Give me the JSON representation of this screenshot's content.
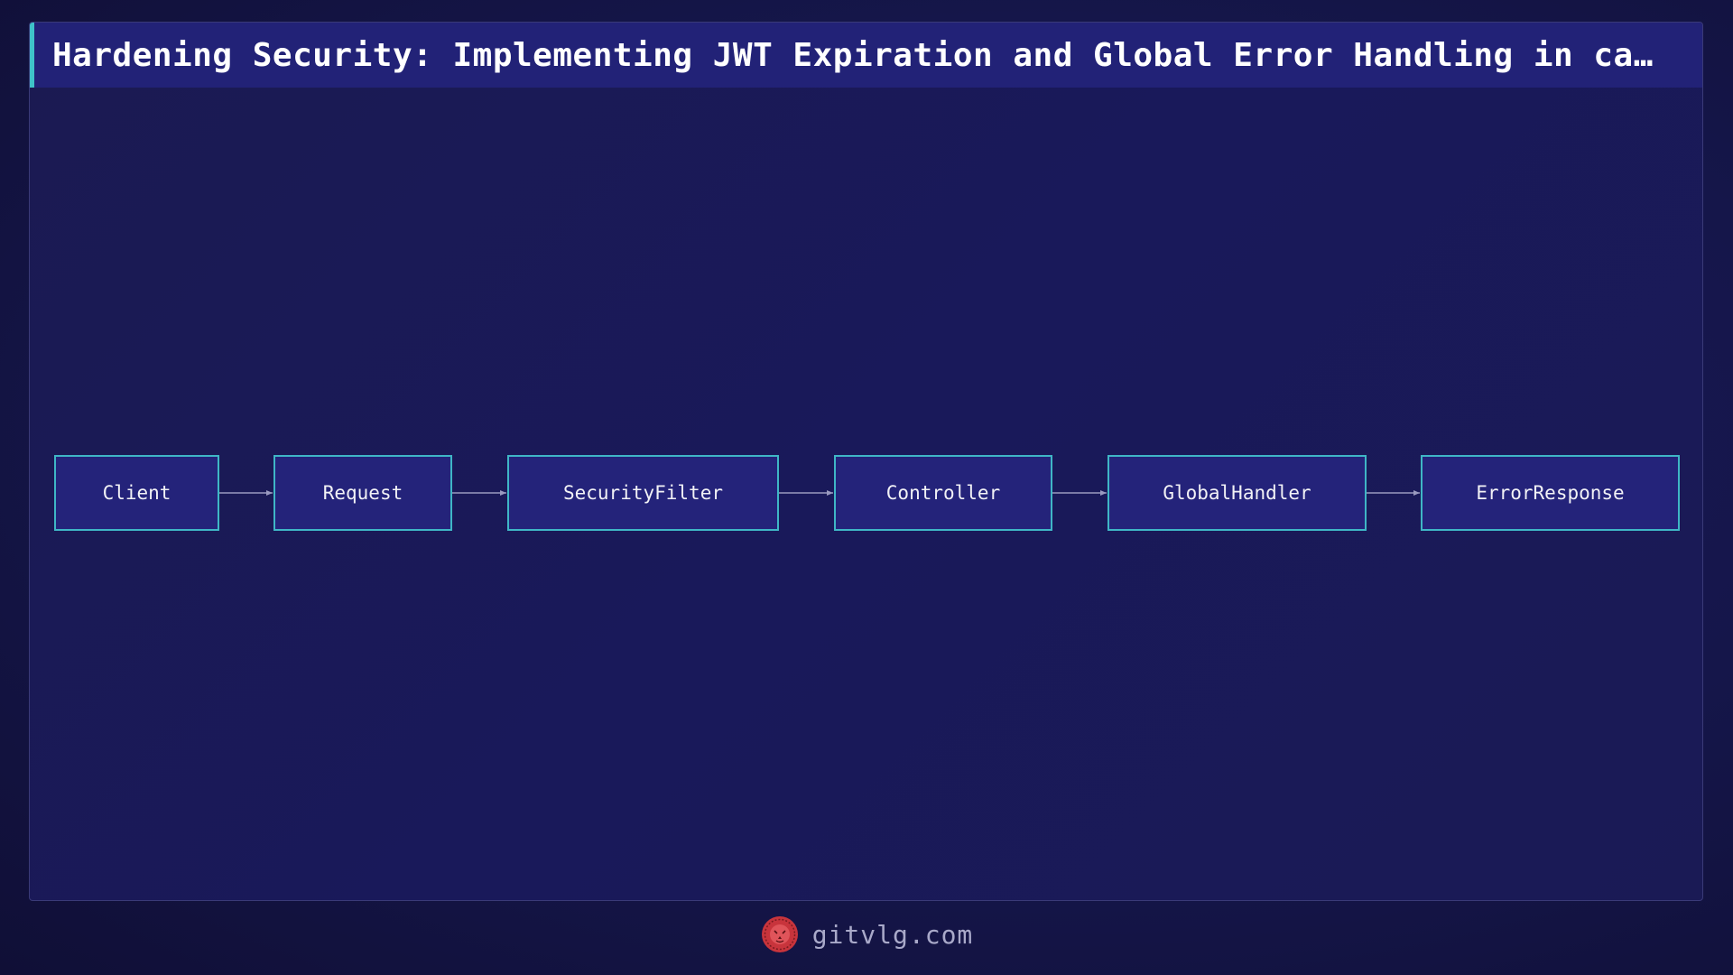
{
  "title": "Hardening Security: Implementing JWT Expiration and Global Error Handling in ca…",
  "diagram": {
    "nodes": [
      {
        "id": "client",
        "label": "Client"
      },
      {
        "id": "request",
        "label": "Request"
      },
      {
        "id": "security-filter",
        "label": "SecurityFilter"
      },
      {
        "id": "controller",
        "label": "Controller"
      },
      {
        "id": "global-handler",
        "label": "GlobalHandler"
      },
      {
        "id": "error-response",
        "label": "ErrorResponse"
      }
    ],
    "edges": [
      {
        "from": "client",
        "to": "request"
      },
      {
        "from": "request",
        "to": "security-filter"
      },
      {
        "from": "security-filter",
        "to": "controller"
      },
      {
        "from": "controller",
        "to": "global-handler"
      },
      {
        "from": "global-handler",
        "to": "error-response"
      }
    ]
  },
  "footer": {
    "logo_icon": "lion-icon",
    "site": "gitvlg.com"
  },
  "colors": {
    "background": "#15164a",
    "title_bar": "#222277",
    "title_accent": "#3fc2c8",
    "node_fill": "#24237a",
    "node_border": "#3fb6c6",
    "edge": "#9a9ac0",
    "logo": "#c8343c"
  }
}
